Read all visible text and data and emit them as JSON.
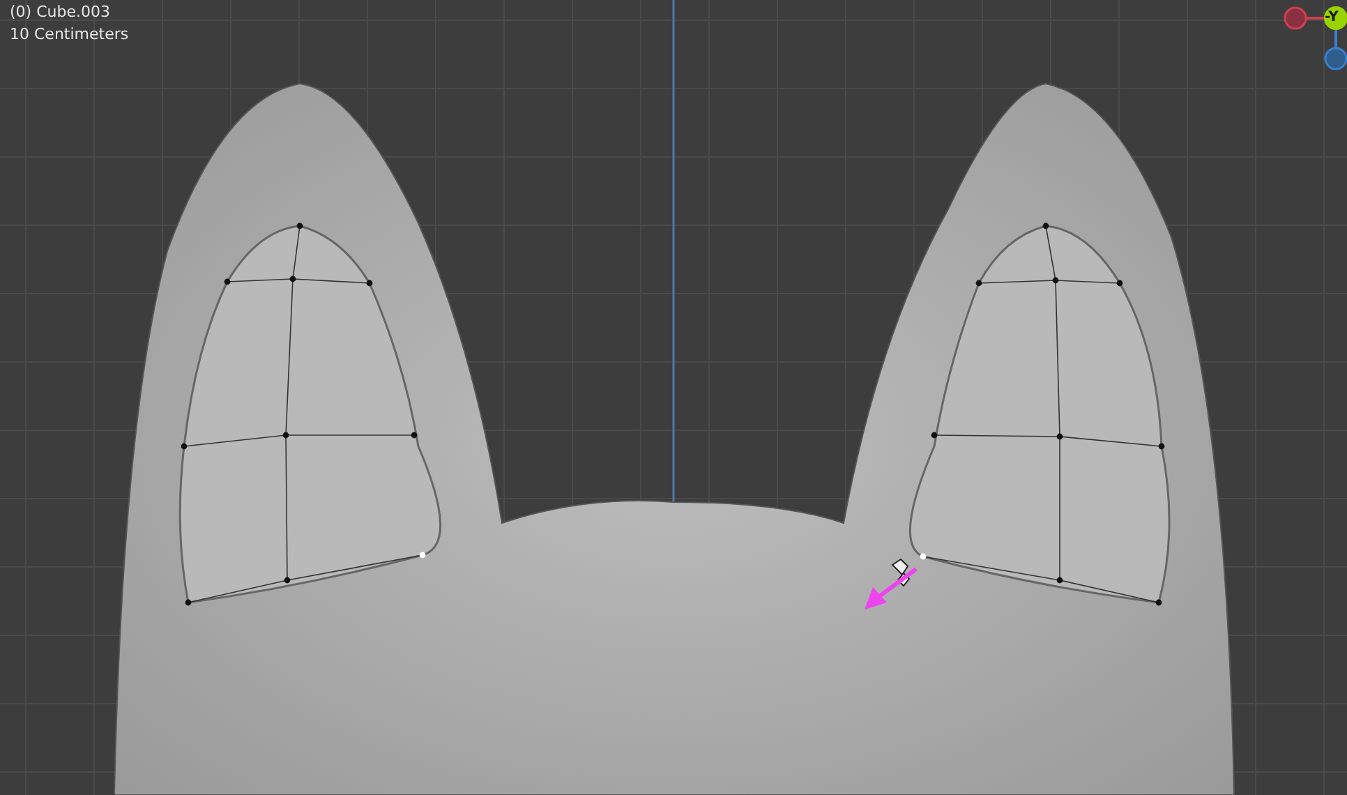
{
  "viewport": {
    "object_label": "(0) Cube.003",
    "scale_label": "10 Centimeters"
  },
  "gizmo": {
    "axis_label": "-Y"
  }
}
